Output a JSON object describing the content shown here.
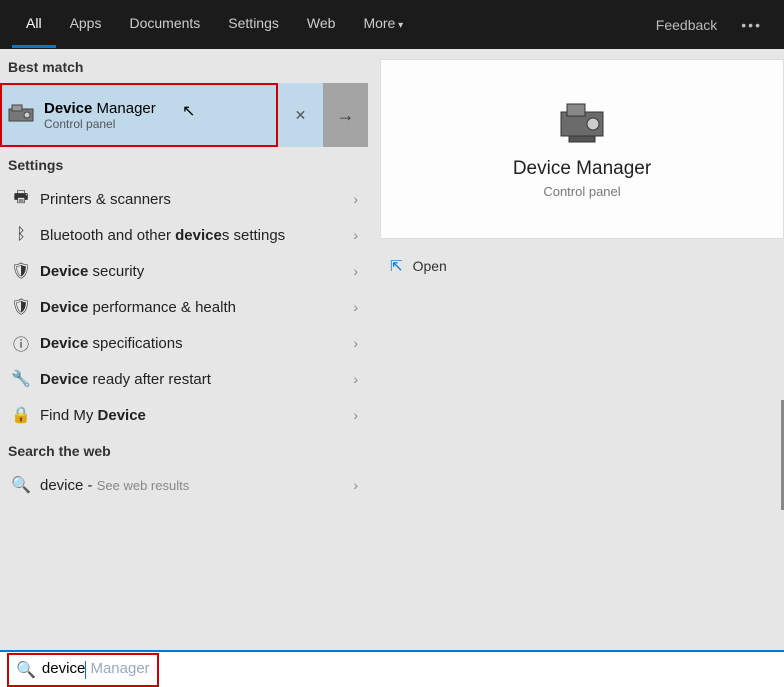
{
  "topbar": {
    "tabs": [
      "All",
      "Apps",
      "Documents",
      "Settings",
      "Web",
      "More"
    ],
    "feedback": "Feedback"
  },
  "sections": {
    "best_match": "Best match",
    "settings": "Settings",
    "search_web": "Search the web"
  },
  "best": {
    "title_strong": "Device",
    "title_rest": " Manager",
    "subtitle": "Control panel"
  },
  "settings_items": [
    {
      "icon": "🖶",
      "label_pre": "Printers & scanners",
      "strong": ""
    },
    {
      "icon": "ᛒ",
      "label_pre": "Bluetooth and other ",
      "strong": "device",
      "label_post": "s settings"
    },
    {
      "icon": "🛡",
      "label_pre": "",
      "strong": "Device",
      "label_post": " security"
    },
    {
      "icon": "🛡",
      "label_pre": "",
      "strong": "Device",
      "label_post": " performance & health"
    },
    {
      "icon": "ⓘ",
      "label_pre": "",
      "strong": "Device",
      "label_post": " specifications"
    },
    {
      "icon": "🔧",
      "label_pre": "",
      "strong": "Device",
      "label_post": " ready after restart"
    },
    {
      "icon": "🔒",
      "label_pre": "Find My ",
      "strong": "Device",
      "label_post": ""
    }
  ],
  "web_item": {
    "icon": "🔍",
    "term": "device",
    "suffix": " - ",
    "hint": "See web results"
  },
  "preview": {
    "title": "Device Manager",
    "subtitle": "Control panel",
    "open": "Open"
  },
  "search": {
    "typed": "device",
    "suggest": " Manager"
  }
}
